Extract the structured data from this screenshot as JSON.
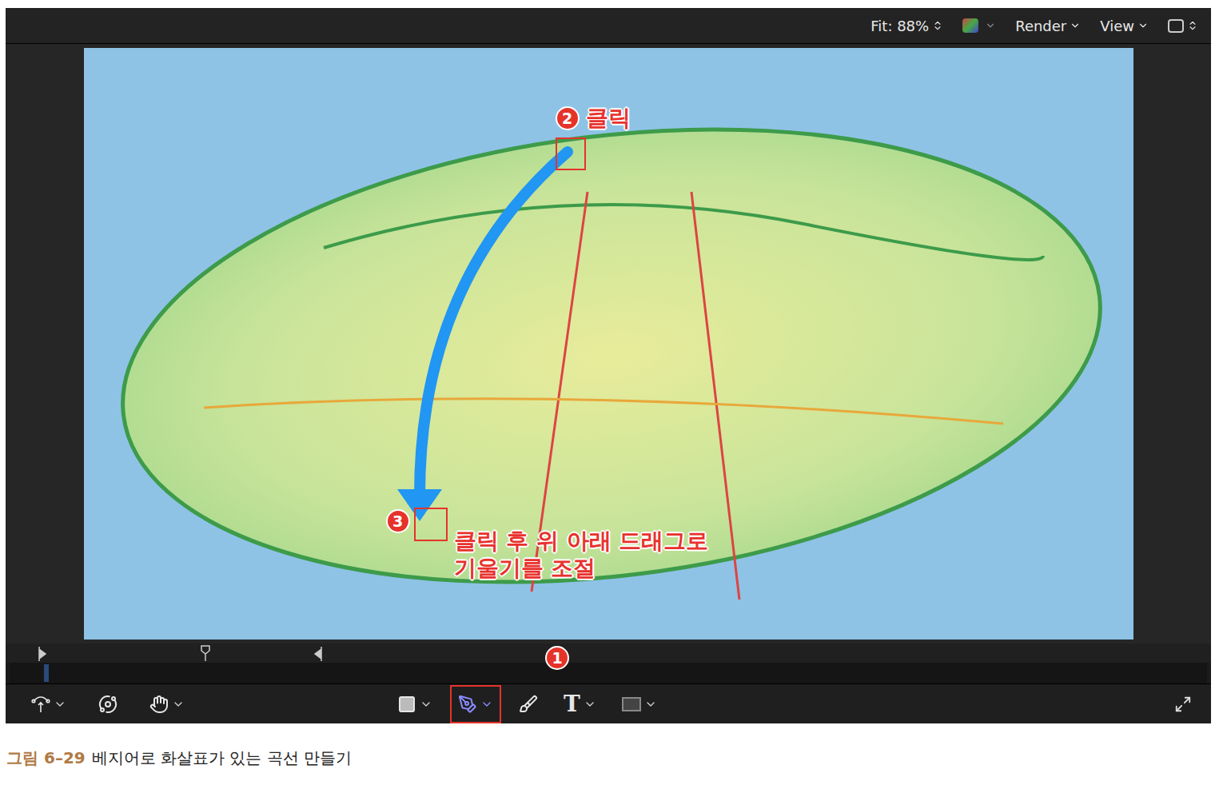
{
  "viewer_bar": {
    "zoom": "Fit: 88%",
    "menus": [
      "Render",
      "View"
    ]
  },
  "annotations": [
    {
      "number": "1"
    },
    {
      "number": "2",
      "lines": [
        "클릭"
      ]
    },
    {
      "number": "3",
      "lines": [
        "클릭 후 위 아래 드래그로",
        "기울기를 조절"
      ]
    }
  ],
  "toolbar": [
    {
      "kind": "transform",
      "selected": false,
      "menu": true
    },
    {
      "kind": "orbit",
      "selected": false,
      "menu": false
    },
    {
      "kind": "hand",
      "selected": false,
      "menu": true
    },
    {
      "kind": "shape",
      "selected": false,
      "menu": true
    },
    {
      "kind": "pen",
      "selected": true,
      "menu": true
    },
    {
      "kind": "brush",
      "selected": false,
      "menu": false
    },
    {
      "kind": "text",
      "label": "T",
      "selected": false,
      "menu": true
    },
    {
      "kind": "mask",
      "selected": false,
      "menu": true
    }
  ],
  "caption": {
    "figure": "그림 6–29",
    "title": "베지어로 화살표가 있는 곡선 만들기"
  }
}
